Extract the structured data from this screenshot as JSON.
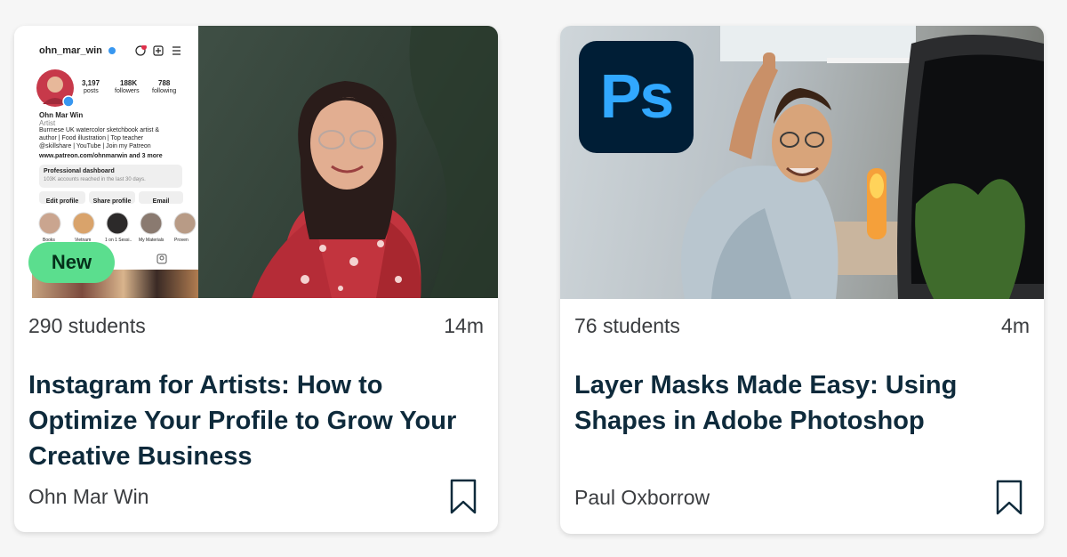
{
  "courses": [
    {
      "students": "290 students",
      "duration": "14m",
      "title": "Instagram for Artists: How to Optimize Your Profile to Grow Your Creative Business",
      "author": "Ohn Mar Win",
      "badge": "New",
      "thumbnail": {
        "profile_handle": "ohn_mar_win",
        "stats": [
          {
            "value": "3,197",
            "label": "posts"
          },
          {
            "value": "188K",
            "label": "followers"
          },
          {
            "value": "788",
            "label": "following"
          }
        ],
        "name": "Ohn Mar Win",
        "role": "Artist",
        "bio_line1": "Burmese UK watercolor sketchbook artist &",
        "bio_line2": "author | Food illustration | Top teacher",
        "bio_line3": "@skillshare | YouTube | Join my Patreon",
        "link": "www.patreon.com/ohnmarwin and 3 more",
        "dashboard_title": "Professional dashboard",
        "dashboard_sub": "103K accounts reached in the last 30 days.",
        "buttons": [
          "Edit profile",
          "Share profile",
          "Email"
        ],
        "highlights": [
          "Books",
          "Vietnam",
          "1 on 1 Sessi..",
          "My Materials",
          "Proven"
        ]
      }
    },
    {
      "students": "76 students",
      "duration": "4m",
      "title": "Layer Masks Made Easy: Using Shapes in Adobe Photoshop",
      "author": "Paul Oxborrow",
      "thumbnail": {
        "logo_text": "Ps"
      }
    }
  ],
  "colors": {
    "badge_bg": "#5bde8e",
    "title": "#0e2a3b",
    "ps_bg": "#001e36",
    "ps_fg": "#31a8ff"
  }
}
